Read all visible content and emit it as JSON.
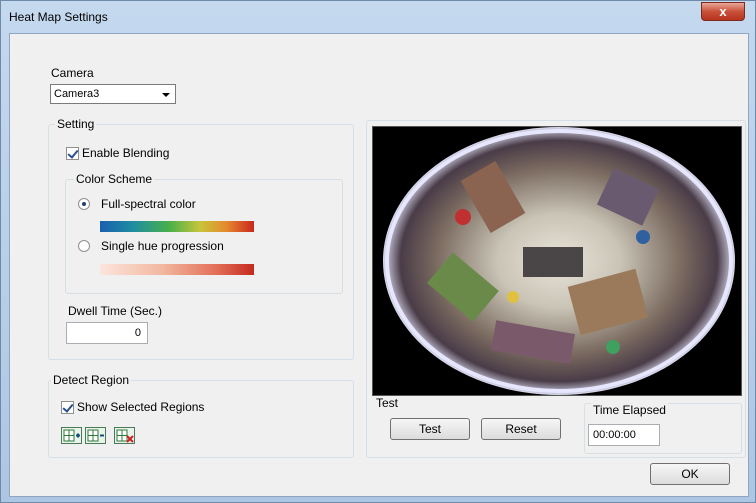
{
  "window": {
    "title": "Heat Map Settings",
    "close_label": "x"
  },
  "camera": {
    "label": "Camera",
    "selected": "Camera3"
  },
  "setting": {
    "group_label": "Setting",
    "enable_blending": {
      "label": "Enable Blending",
      "checked": true
    },
    "color_scheme": {
      "group_label": "Color Scheme",
      "options": [
        {
          "label": "Full-spectral color",
          "selected": true
        },
        {
          "label": "Single hue progression",
          "selected": false
        }
      ]
    },
    "dwell_time": {
      "label": "Dwell Time (Sec.)",
      "value": "0"
    }
  },
  "detect_region": {
    "group_label": "Detect Region",
    "show_selected_regions": {
      "label": "Show Selected Regions",
      "checked": true
    },
    "tools": [
      "add-region-icon",
      "remove-region-icon",
      "clear-region-icon"
    ]
  },
  "test": {
    "group_label": "Test",
    "test_button": "Test",
    "reset_button": "Reset",
    "time_elapsed_label": "Time Elapsed",
    "time_elapsed_value": "00:00:00"
  },
  "ok_button": "OK"
}
